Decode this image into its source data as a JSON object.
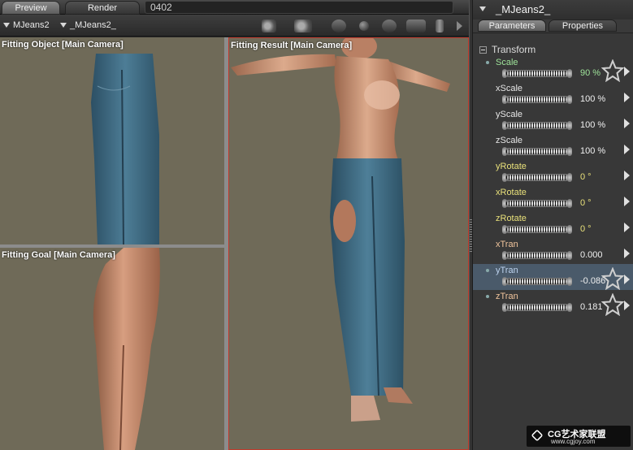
{
  "tabs": [
    {
      "label": "Preview",
      "active": true
    },
    {
      "label": "Render",
      "active": false
    }
  ],
  "frame_field": {
    "value": "0402"
  },
  "toolbar": {
    "figure_select": "MJeans2",
    "actor_select": "_MJeans2_"
  },
  "viewports": {
    "fitting_object": "Fitting Object [Main Camera]",
    "fitting_goal": "Fitting Goal [Main Camera]",
    "fitting_result": "Fitting Result [Main Camera]"
  },
  "panel": {
    "title": "_MJeans2_",
    "tabs": [
      "Parameters",
      "Properties"
    ],
    "section": "Transform",
    "params": [
      {
        "name": "Scale",
        "value": "90 %",
        "color": "#9fe49a"
      },
      {
        "name": "xScale",
        "value": "100 %",
        "color": "#e6e6e6"
      },
      {
        "name": "yScale",
        "value": "100 %",
        "color": "#e6e6e6"
      },
      {
        "name": "zScale",
        "value": "100 %",
        "color": "#e6e6e6"
      },
      {
        "name": "yRotate",
        "value": "0 °",
        "color": "#e8e07a"
      },
      {
        "name": "xRotate",
        "value": "0 °",
        "color": "#e8e07a"
      },
      {
        "name": "zRotate",
        "value": "0 °",
        "color": "#e8e07a"
      },
      {
        "name": "xTran",
        "value": "0.000",
        "color": "#f0c49c"
      },
      {
        "name": "yTran",
        "value": "-0.086",
        "color": "#bcd2ee"
      },
      {
        "name": "zTran",
        "value": "0.181",
        "color": "#f0c49c"
      }
    ]
  },
  "watermark": {
    "main": "CG艺术家联盟",
    "sub": "www.cgjoy.com"
  }
}
